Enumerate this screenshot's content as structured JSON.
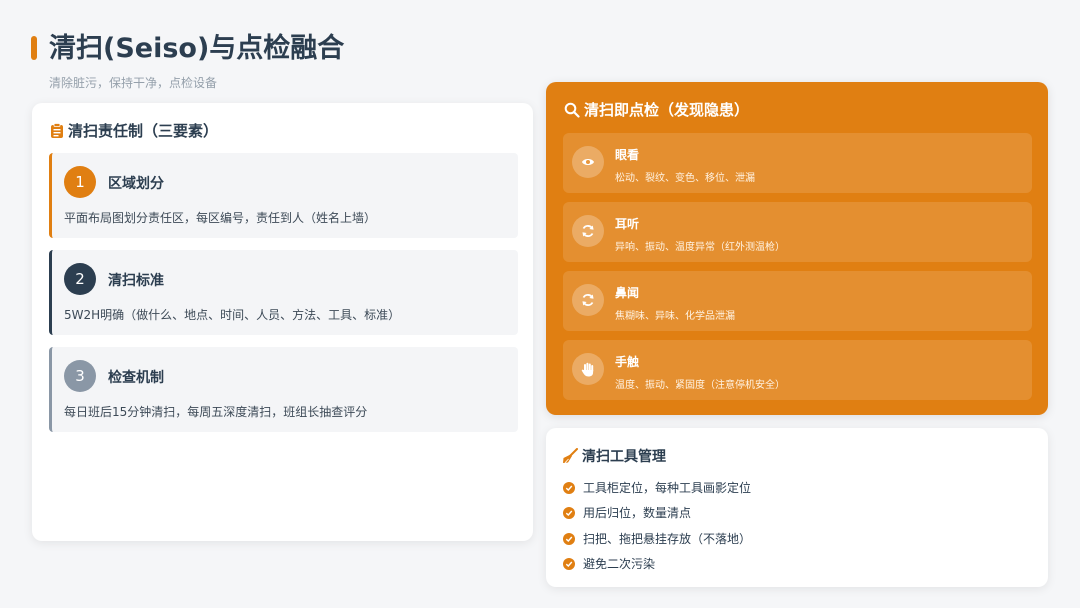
{
  "header": {
    "title": "清扫(Seiso)与点检融合",
    "subtitle": "清除脏污，保持干净，点检设备"
  },
  "colors": {
    "accent": "#e07f12",
    "dark": "#2c3e50",
    "muted": "#95a0ab"
  },
  "responsibility": {
    "title": "清扫责任制（三要素）",
    "icon": "clipboard-icon",
    "items": [
      {
        "num": "1",
        "title": "区域划分",
        "desc": "平面布局图划分责任区，每区编号，责任到人（姓名上墙）",
        "color": "#e07f12"
      },
      {
        "num": "2",
        "title": "清扫标准",
        "desc": "5W2H明确（做什么、地点、时间、人员、方法、工具、标准）",
        "color": "#2c3e50"
      },
      {
        "num": "3",
        "title": "检查机制",
        "desc": "每日班后15分钟清扫，每周五深度清扫，班组长抽查评分",
        "color": "#8a97a6"
      }
    ]
  },
  "inspection": {
    "title": "清扫即点检（发现隐患）",
    "icon": "search-icon",
    "items": [
      {
        "title": "眼看",
        "desc": "松动、裂纹、变色、移位、泄漏",
        "icon": "eye-icon"
      },
      {
        "title": "耳听",
        "desc": "异响、振动、温度异常（红外测温枪）",
        "icon": "refresh-icon"
      },
      {
        "title": "鼻闻",
        "desc": "焦糊味、异味、化学品泄漏",
        "icon": "refresh-icon"
      },
      {
        "title": "手触",
        "desc": "温度、振动、紧固度（注意停机安全）",
        "icon": "hand-icon"
      }
    ]
  },
  "tools": {
    "title": "清扫工具管理",
    "icon": "broom-icon",
    "items": [
      "工具柜定位，每种工具画影定位",
      "用后归位，数量清点",
      "扫把、拖把悬挂存放（不落地）",
      "避免二次污染"
    ]
  }
}
